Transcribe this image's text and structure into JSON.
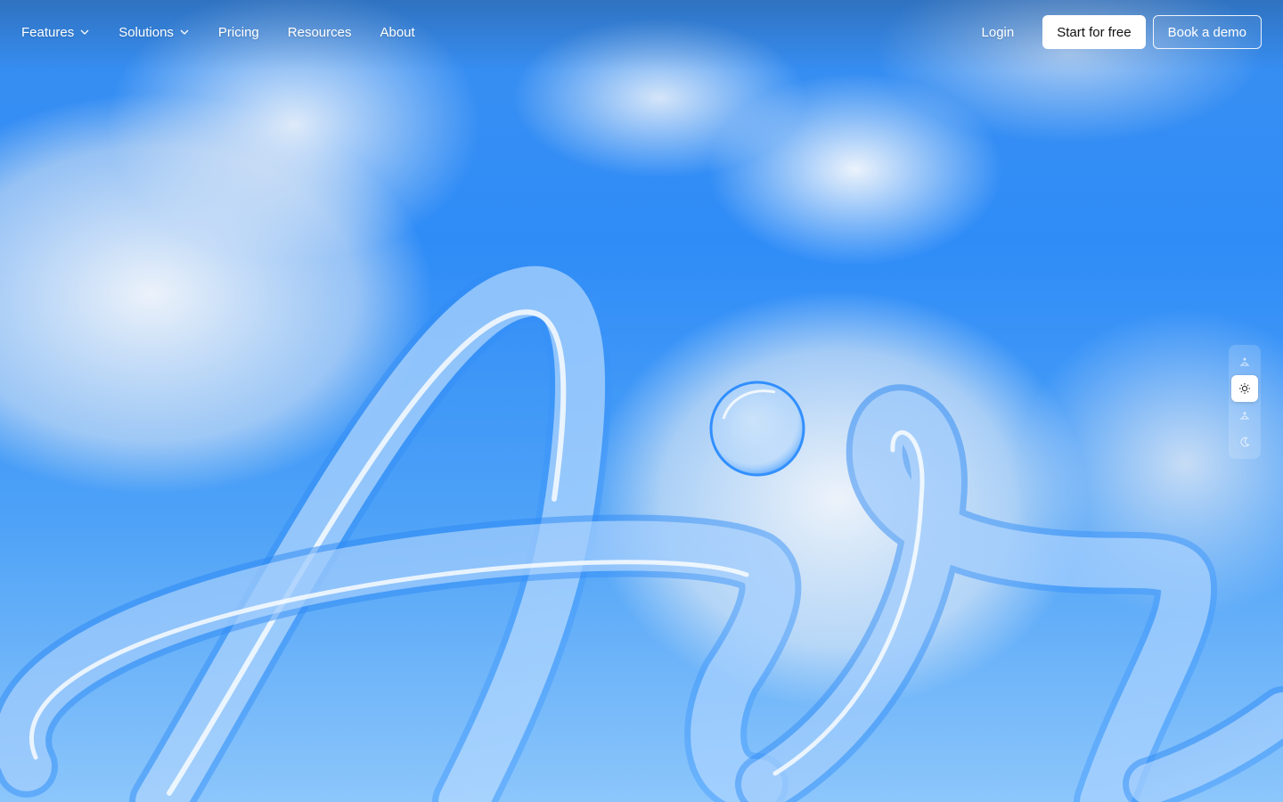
{
  "nav": {
    "items": [
      {
        "label": "Features",
        "dropdown": true
      },
      {
        "label": "Solutions",
        "dropdown": true
      },
      {
        "label": "Pricing",
        "dropdown": false
      },
      {
        "label": "Resources",
        "dropdown": false
      },
      {
        "label": "About",
        "dropdown": false
      }
    ],
    "login_label": "Login",
    "start_label": "Start for free",
    "demo_label": "Book a demo"
  },
  "hero": {
    "art_description_icon": "air-glass-script-art",
    "background": "sky-clouds"
  },
  "theme_switcher": {
    "options": [
      {
        "icon": "sunrise-icon",
        "active": false
      },
      {
        "icon": "sun-icon",
        "active": true
      },
      {
        "icon": "sunset-icon",
        "active": false
      },
      {
        "icon": "moon-icon",
        "active": false
      }
    ]
  },
  "colors": {
    "sky": "#2f8cf5",
    "glass": "#cfe6ff",
    "glass_edge": "#1f7ff0",
    "text": "#ffffff",
    "button_bg": "#ffffff",
    "button_text": "#111111"
  }
}
